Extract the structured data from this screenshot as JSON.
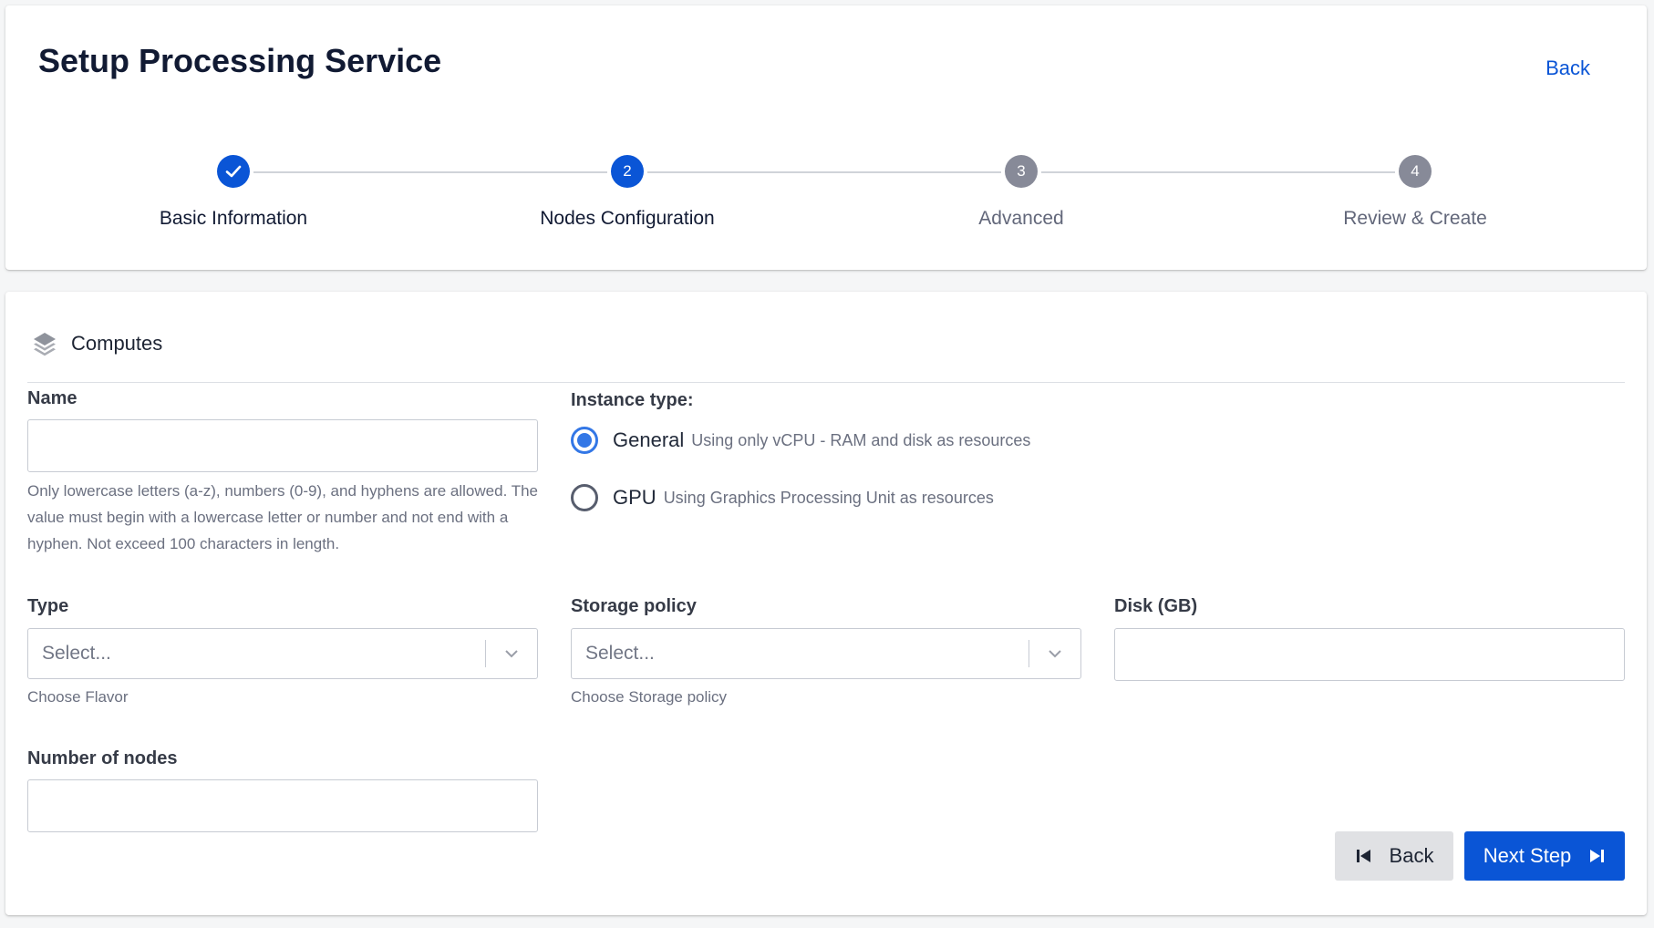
{
  "header": {
    "title": "Setup Processing Service",
    "back_label": "Back"
  },
  "stepper": {
    "steps": [
      {
        "number": "1",
        "label": "Basic Information",
        "state": "done"
      },
      {
        "number": "2",
        "label": "Nodes Configuration",
        "state": "active"
      },
      {
        "number": "3",
        "label": "Advanced",
        "state": "pending"
      },
      {
        "number": "4",
        "label": "Review & Create",
        "state": "pending"
      }
    ]
  },
  "computes": {
    "section_title": "Computes",
    "name": {
      "label": "Name",
      "value": "",
      "help": "Only lowercase letters (a-z), numbers (0-9), and hyphens are allowed. The value must begin with a lowercase letter or number and not end with a hyphen. Not exceed 100 characters in length."
    },
    "instance_type": {
      "label": "Instance type:",
      "selected": "General",
      "options": [
        {
          "title": "General",
          "description": "Using only vCPU - RAM and disk as resources"
        },
        {
          "title": "GPU",
          "description": "Using Graphics Processing Unit as resources"
        }
      ]
    },
    "type": {
      "label": "Type",
      "placeholder": "Select...",
      "help": "Choose Flavor"
    },
    "storage_policy": {
      "label": "Storage policy",
      "placeholder": "Select...",
      "help": "Choose Storage policy"
    },
    "disk": {
      "label": "Disk (GB)",
      "value": ""
    },
    "nodes": {
      "label": "Number of nodes",
      "value": ""
    }
  },
  "footer": {
    "back_label": "Back",
    "next_label": "Next Step"
  },
  "colors": {
    "primary": "#0a55d6",
    "radio_checked": "#3377e6",
    "pending_step": "#878a98"
  }
}
